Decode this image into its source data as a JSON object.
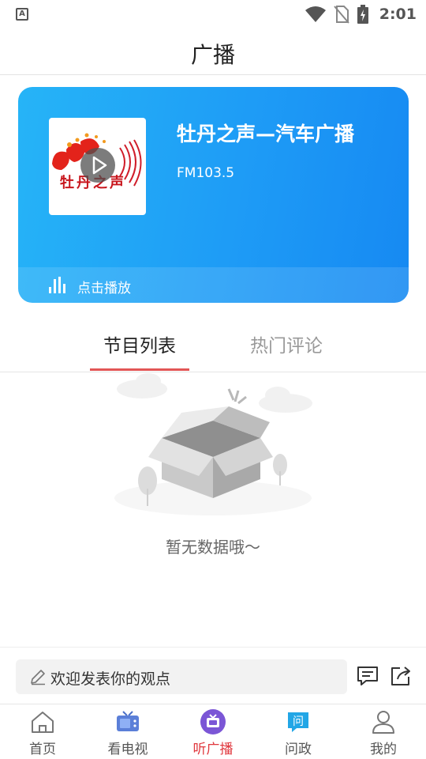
{
  "status_bar": {
    "app_icon_letter": "A",
    "time": "2:01"
  },
  "header": {
    "title": "广播"
  },
  "player": {
    "cover_logo_text": "牡丹之声",
    "station_name": "牡丹之声—汽车广播",
    "frequency": "FM103.5",
    "play_label": "点击播放"
  },
  "tabs": [
    {
      "label": "节目列表",
      "active": true
    },
    {
      "label": "热门评论",
      "active": false
    }
  ],
  "empty_state": {
    "text": "暂无数据哦～"
  },
  "comment_bar": {
    "placeholder": "欢迎发表你的观点"
  },
  "bottom_nav": [
    {
      "label": "首页",
      "icon": "home-icon",
      "active": false
    },
    {
      "label": "看电视",
      "icon": "tv-icon",
      "active": false
    },
    {
      "label": "听广播",
      "icon": "radio-icon",
      "active": true
    },
    {
      "label": "问政",
      "icon": "ask-icon",
      "active": false
    },
    {
      "label": "我的",
      "icon": "profile-icon",
      "active": false
    }
  ],
  "colors": {
    "accent": "#e0383e",
    "card_blue": "#1e9cf6",
    "tab_indicator": "#e25555"
  }
}
